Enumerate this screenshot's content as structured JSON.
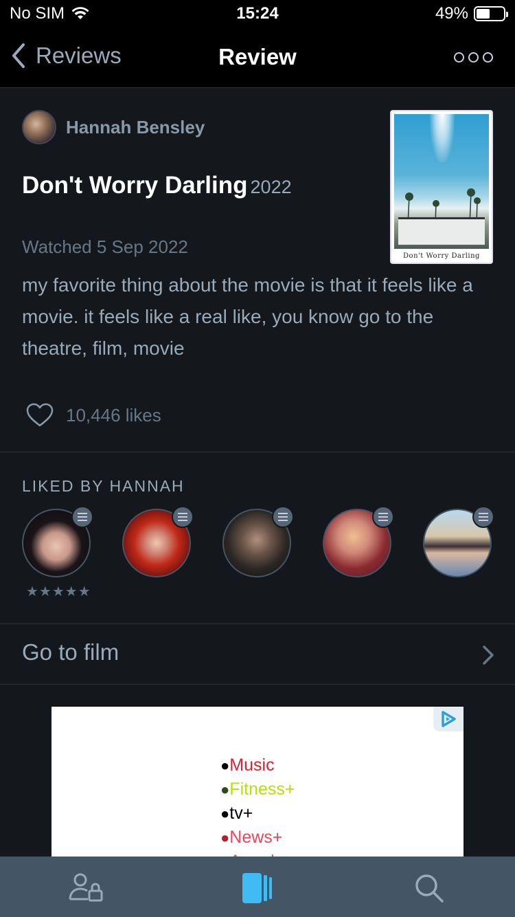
{
  "status_bar": {
    "carrier": "No SIM",
    "time": "15:24",
    "battery": "49%",
    "battery_level": 0.49
  },
  "nav": {
    "back_label": "Reviews",
    "title": "Review"
  },
  "review": {
    "author": "Hannah Bensley",
    "film_title": "Don't Worry Darling",
    "film_year": "2022",
    "watched": "Watched 5 Sep 2022",
    "text": "my favorite thing about the movie is that it feels like a movie. it feels like a real like, you know go to the theatre, film, movie",
    "likes": "10,446 likes",
    "poster_title": "Don't Worry Darling"
  },
  "liked_by": {
    "heading": "LIKED BY HANNAH",
    "friends": [
      {
        "rating": "★★★★★"
      },
      {
        "rating": ""
      },
      {
        "rating": ""
      },
      {
        "rating": ""
      },
      {
        "rating": ""
      }
    ]
  },
  "goto_film": {
    "label": "Go to film"
  },
  "ad": {
    "items": [
      {
        "text": "Music",
        "color": "#e0202c"
      },
      {
        "text": "Fitness+",
        "color": "#b8e000"
      },
      {
        "text": "tv+",
        "color": "#000000"
      },
      {
        "text": "News+",
        "color": "#f5425a"
      },
      {
        "text": "Arcade",
        "color": "#f05a28"
      }
    ]
  },
  "colors": {
    "background": "#14181c",
    "tabbar": "#445566",
    "accent_blue": "#40bcf4",
    "text_secondary": "#99aabb"
  }
}
